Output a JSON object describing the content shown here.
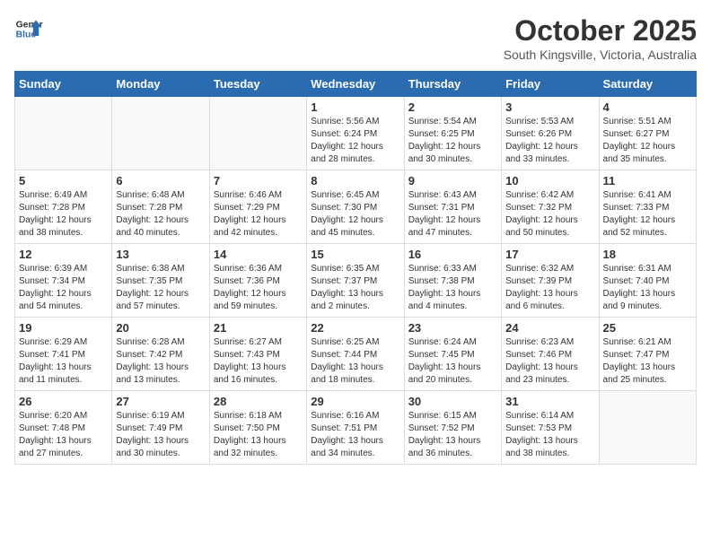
{
  "header": {
    "logo_line1": "General",
    "logo_line2": "Blue",
    "month": "October 2025",
    "location": "South Kingsville, Victoria, Australia"
  },
  "days_of_week": [
    "Sunday",
    "Monday",
    "Tuesday",
    "Wednesday",
    "Thursday",
    "Friday",
    "Saturday"
  ],
  "weeks": [
    [
      {
        "day": "",
        "info": ""
      },
      {
        "day": "",
        "info": ""
      },
      {
        "day": "",
        "info": ""
      },
      {
        "day": "1",
        "info": "Sunrise: 5:56 AM\nSunset: 6:24 PM\nDaylight: 12 hours\nand 28 minutes."
      },
      {
        "day": "2",
        "info": "Sunrise: 5:54 AM\nSunset: 6:25 PM\nDaylight: 12 hours\nand 30 minutes."
      },
      {
        "day": "3",
        "info": "Sunrise: 5:53 AM\nSunset: 6:26 PM\nDaylight: 12 hours\nand 33 minutes."
      },
      {
        "day": "4",
        "info": "Sunrise: 5:51 AM\nSunset: 6:27 PM\nDaylight: 12 hours\nand 35 minutes."
      }
    ],
    [
      {
        "day": "5",
        "info": "Sunrise: 6:49 AM\nSunset: 7:28 PM\nDaylight: 12 hours\nand 38 minutes."
      },
      {
        "day": "6",
        "info": "Sunrise: 6:48 AM\nSunset: 7:28 PM\nDaylight: 12 hours\nand 40 minutes."
      },
      {
        "day": "7",
        "info": "Sunrise: 6:46 AM\nSunset: 7:29 PM\nDaylight: 12 hours\nand 42 minutes."
      },
      {
        "day": "8",
        "info": "Sunrise: 6:45 AM\nSunset: 7:30 PM\nDaylight: 12 hours\nand 45 minutes."
      },
      {
        "day": "9",
        "info": "Sunrise: 6:43 AM\nSunset: 7:31 PM\nDaylight: 12 hours\nand 47 minutes."
      },
      {
        "day": "10",
        "info": "Sunrise: 6:42 AM\nSunset: 7:32 PM\nDaylight: 12 hours\nand 50 minutes."
      },
      {
        "day": "11",
        "info": "Sunrise: 6:41 AM\nSunset: 7:33 PM\nDaylight: 12 hours\nand 52 minutes."
      }
    ],
    [
      {
        "day": "12",
        "info": "Sunrise: 6:39 AM\nSunset: 7:34 PM\nDaylight: 12 hours\nand 54 minutes."
      },
      {
        "day": "13",
        "info": "Sunrise: 6:38 AM\nSunset: 7:35 PM\nDaylight: 12 hours\nand 57 minutes."
      },
      {
        "day": "14",
        "info": "Sunrise: 6:36 AM\nSunset: 7:36 PM\nDaylight: 12 hours\nand 59 minutes."
      },
      {
        "day": "15",
        "info": "Sunrise: 6:35 AM\nSunset: 7:37 PM\nDaylight: 13 hours\nand 2 minutes."
      },
      {
        "day": "16",
        "info": "Sunrise: 6:33 AM\nSunset: 7:38 PM\nDaylight: 13 hours\nand 4 minutes."
      },
      {
        "day": "17",
        "info": "Sunrise: 6:32 AM\nSunset: 7:39 PM\nDaylight: 13 hours\nand 6 minutes."
      },
      {
        "day": "18",
        "info": "Sunrise: 6:31 AM\nSunset: 7:40 PM\nDaylight: 13 hours\nand 9 minutes."
      }
    ],
    [
      {
        "day": "19",
        "info": "Sunrise: 6:29 AM\nSunset: 7:41 PM\nDaylight: 13 hours\nand 11 minutes."
      },
      {
        "day": "20",
        "info": "Sunrise: 6:28 AM\nSunset: 7:42 PM\nDaylight: 13 hours\nand 13 minutes."
      },
      {
        "day": "21",
        "info": "Sunrise: 6:27 AM\nSunset: 7:43 PM\nDaylight: 13 hours\nand 16 minutes."
      },
      {
        "day": "22",
        "info": "Sunrise: 6:25 AM\nSunset: 7:44 PM\nDaylight: 13 hours\nand 18 minutes."
      },
      {
        "day": "23",
        "info": "Sunrise: 6:24 AM\nSunset: 7:45 PM\nDaylight: 13 hours\nand 20 minutes."
      },
      {
        "day": "24",
        "info": "Sunrise: 6:23 AM\nSunset: 7:46 PM\nDaylight: 13 hours\nand 23 minutes."
      },
      {
        "day": "25",
        "info": "Sunrise: 6:21 AM\nSunset: 7:47 PM\nDaylight: 13 hours\nand 25 minutes."
      }
    ],
    [
      {
        "day": "26",
        "info": "Sunrise: 6:20 AM\nSunset: 7:48 PM\nDaylight: 13 hours\nand 27 minutes."
      },
      {
        "day": "27",
        "info": "Sunrise: 6:19 AM\nSunset: 7:49 PM\nDaylight: 13 hours\nand 30 minutes."
      },
      {
        "day": "28",
        "info": "Sunrise: 6:18 AM\nSunset: 7:50 PM\nDaylight: 13 hours\nand 32 minutes."
      },
      {
        "day": "29",
        "info": "Sunrise: 6:16 AM\nSunset: 7:51 PM\nDaylight: 13 hours\nand 34 minutes."
      },
      {
        "day": "30",
        "info": "Sunrise: 6:15 AM\nSunset: 7:52 PM\nDaylight: 13 hours\nand 36 minutes."
      },
      {
        "day": "31",
        "info": "Sunrise: 6:14 AM\nSunset: 7:53 PM\nDaylight: 13 hours\nand 38 minutes."
      },
      {
        "day": "",
        "info": ""
      }
    ]
  ]
}
